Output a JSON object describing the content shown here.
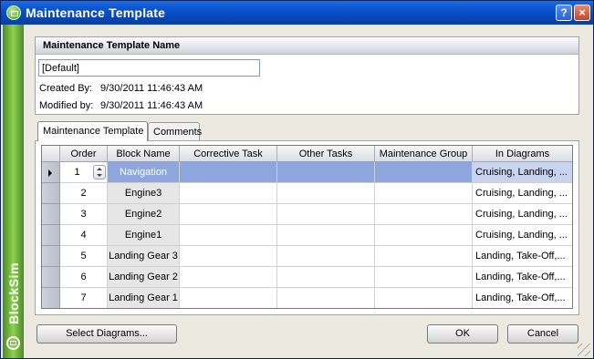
{
  "window": {
    "title": "Maintenance Template",
    "help_label": "?",
    "close_label": "×"
  },
  "brand": {
    "text": "BlockSim"
  },
  "template": {
    "header": "Maintenance Template Name",
    "name_value": "[Default]",
    "created_label": "Created By:",
    "created_value": "9/30/2011 11:46:43 AM",
    "modified_label": "Modified by:",
    "modified_value": "9/30/2011 11:46:43 AM"
  },
  "tabs": [
    {
      "label": "Maintenance Template",
      "active": true
    },
    {
      "label": "Comments",
      "active": false
    }
  ],
  "grid": {
    "columns": [
      "Order",
      "Block Name",
      "Corrective Task",
      "Other Tasks",
      "Maintenance Group",
      "In Diagrams"
    ],
    "rows": [
      {
        "order": "1",
        "block": "Navigation",
        "corrective": "",
        "other": "",
        "group": "",
        "diagrams": "Cruising, Landing, ..."
      },
      {
        "order": "2",
        "block": "Engine3",
        "corrective": "",
        "other": "",
        "group": "",
        "diagrams": "Cruising, Landing, ..."
      },
      {
        "order": "3",
        "block": "Engine2",
        "corrective": "",
        "other": "",
        "group": "",
        "diagrams": "Cruising, Landing, ..."
      },
      {
        "order": "4",
        "block": "Engine1",
        "corrective": "",
        "other": "",
        "group": "",
        "diagrams": "Cruising, Landing, ..."
      },
      {
        "order": "5",
        "block": "Landing Gear 3",
        "corrective": "",
        "other": "",
        "group": "",
        "diagrams": "Landing, Take-Off,..."
      },
      {
        "order": "6",
        "block": "Landing Gear 2",
        "corrective": "",
        "other": "",
        "group": "",
        "diagrams": "Landing, Take-Off,..."
      },
      {
        "order": "7",
        "block": "Landing Gear 1",
        "corrective": "",
        "other": "",
        "group": "",
        "diagrams": "Landing, Take-Off,..."
      }
    ]
  },
  "buttons": {
    "select_diagrams": "Select Diagrams...",
    "ok": "OK",
    "cancel": "Cancel"
  }
}
